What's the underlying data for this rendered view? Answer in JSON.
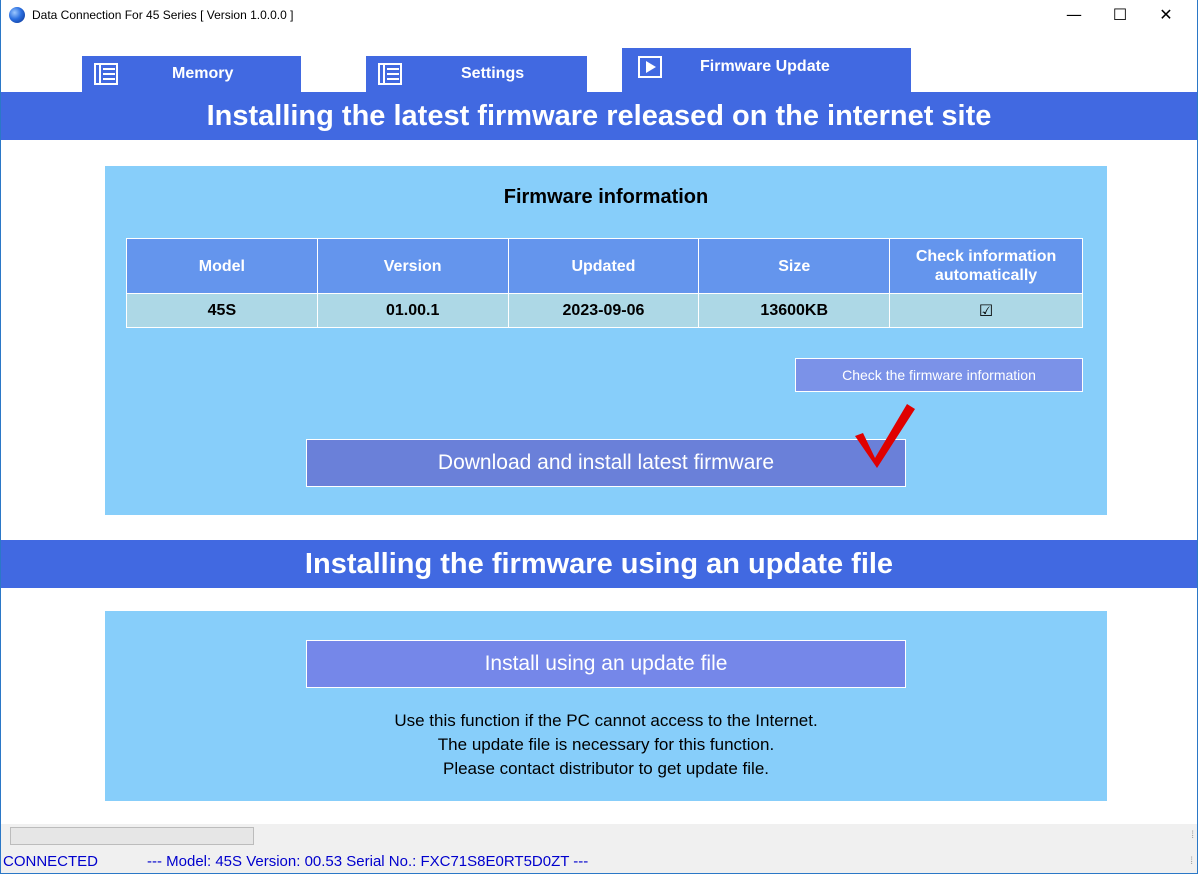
{
  "window": {
    "title": "Data Connection For 45 Series [ Version 1.0.0.0 ]",
    "controls": {
      "minimize": "—",
      "maximize": "☐",
      "close": "✕"
    }
  },
  "tabs": [
    {
      "label": "Memory",
      "icon": "list-icon",
      "active": false
    },
    {
      "label": "Settings",
      "icon": "list-icon",
      "active": false
    },
    {
      "label": "Firmware Update",
      "icon": "play-icon",
      "active": true
    }
  ],
  "online_section": {
    "banner": "Installing the latest firmware released on the internet site",
    "panel_title": "Firmware information",
    "table": {
      "headers": [
        "Model",
        "Version",
        "Updated",
        "Size",
        "Check information automatically"
      ],
      "header_auto_line1": "Check information",
      "header_auto_line2": "automatically",
      "row": {
        "model": "45S",
        "version": "01.00.1",
        "updated": "2023-09-06",
        "size": "13600KB",
        "auto_check": "☑"
      }
    },
    "check_button": "Check the firmware information",
    "download_button": "Download and install latest firmware"
  },
  "file_section": {
    "banner": "Installing the firmware using an update file",
    "install_button": "Install using an update file",
    "note_lines": [
      "Use this function if the PC cannot access to the Internet.",
      "The update file is necessary for this function.",
      "Please contact distributor to get update file."
    ]
  },
  "status": {
    "connection": "CONNECTED",
    "details": "---  Model: 45S   Version: 00.53   Serial No.: FXC71S8E0RT5D0ZT   ---"
  },
  "colors": {
    "accent_blue": "#4169e1",
    "panel_blue": "#87cefa",
    "header_blue": "#6495ed",
    "row_blue": "#add8e6",
    "annotation_red": "#e00000",
    "status_text": "#0000cd"
  }
}
